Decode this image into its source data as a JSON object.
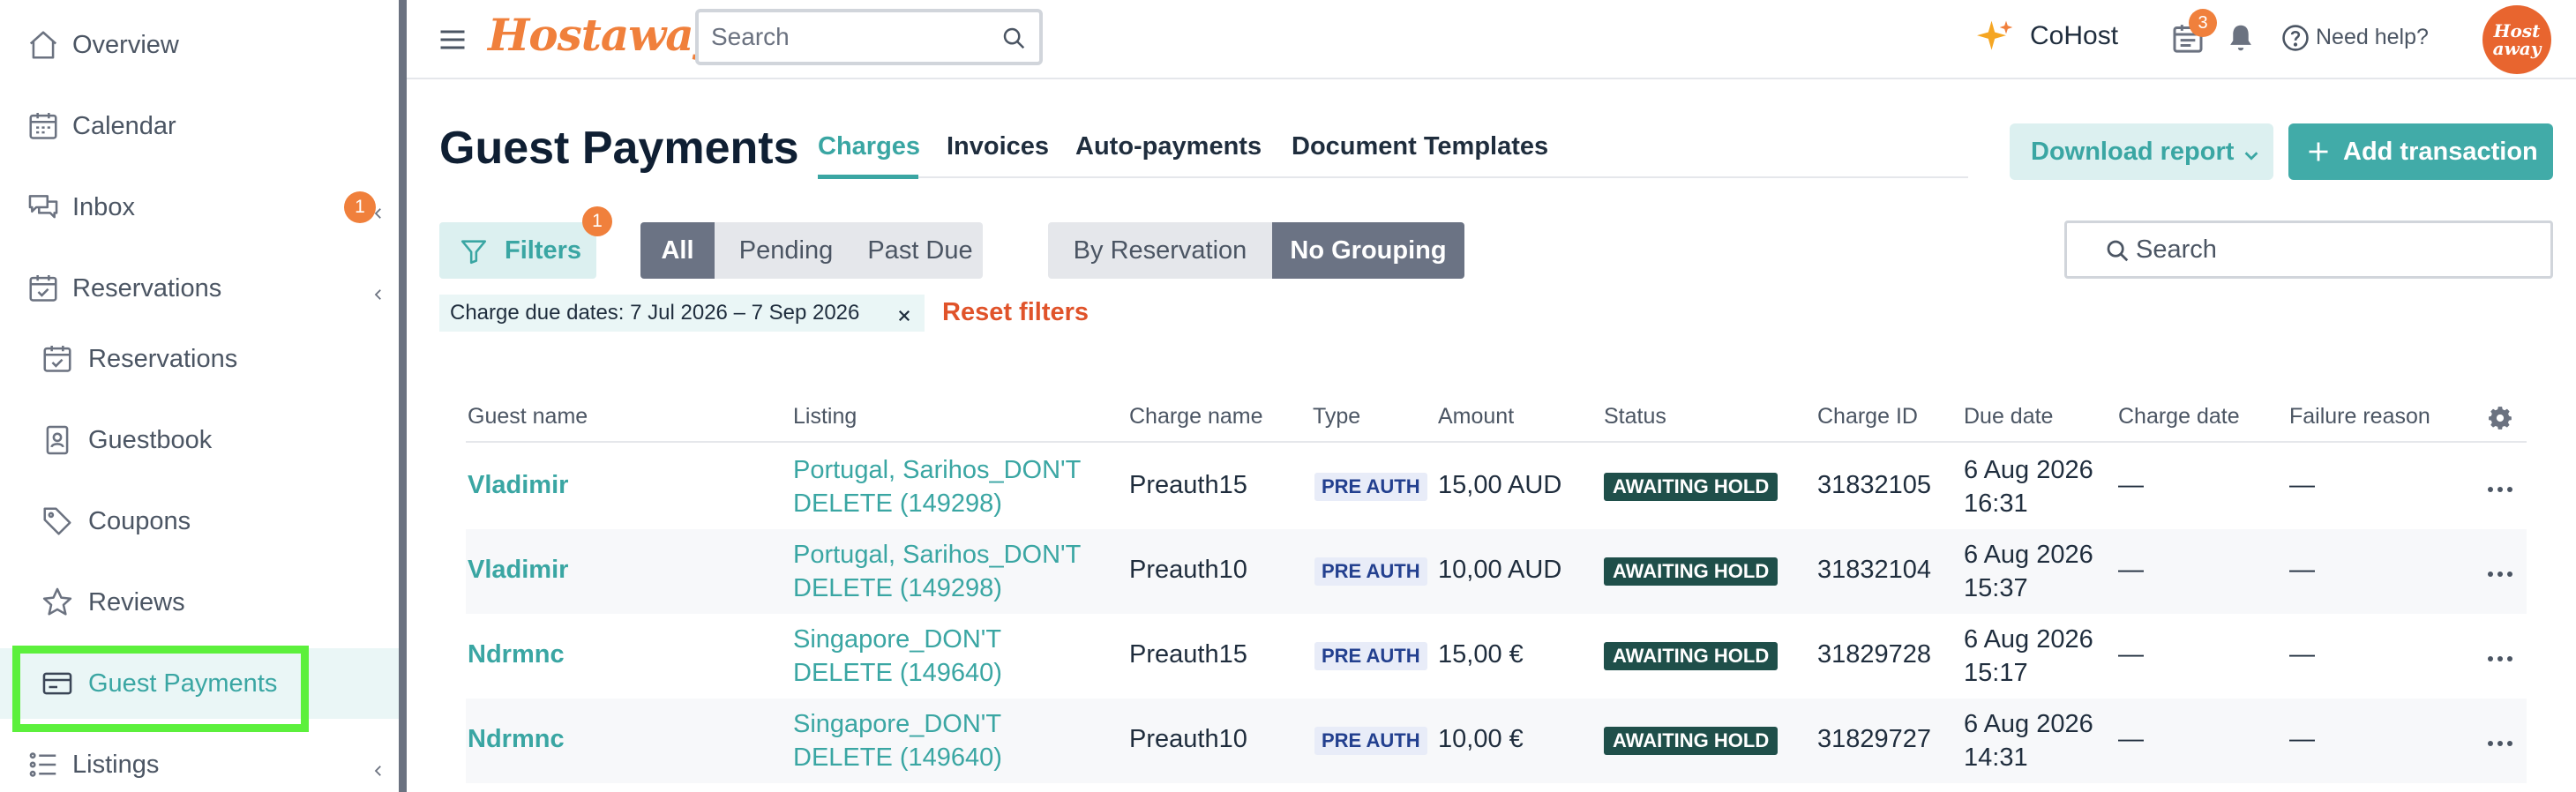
{
  "sidebar": {
    "items": [
      {
        "label": "Overview",
        "icon": "home-icon"
      },
      {
        "label": "Calendar",
        "icon": "calendar-icon"
      },
      {
        "label": "Inbox",
        "icon": "chat-icon",
        "badge": "1"
      },
      {
        "label": "Reservations",
        "icon": "calendar-check-icon"
      },
      {
        "label": "Reservations",
        "icon": "calendar-check-icon"
      },
      {
        "label": "Guestbook",
        "icon": "guestbook-icon"
      },
      {
        "label": "Coupons",
        "icon": "tag-icon"
      },
      {
        "label": "Reviews",
        "icon": "star-icon"
      },
      {
        "label": "Guest Payments",
        "icon": "credit-card-icon"
      },
      {
        "label": "Listings",
        "icon": "list-icon"
      }
    ]
  },
  "topbar": {
    "logo": "Hostaway",
    "search_placeholder": "Search",
    "cohost_label": "CoHost",
    "calendar_badge": "3",
    "help_label": "Need help?",
    "avatar_line1": "Host",
    "avatar_line2": "away"
  },
  "page": {
    "title": "Guest Payments",
    "tabs": [
      "Charges",
      "Invoices",
      "Auto-payments",
      "Document Templates"
    ],
    "active_tab": "Charges",
    "download_label": "Download report",
    "add_label": "Add transaction"
  },
  "filters": {
    "label": "Filters",
    "badge": "1",
    "status_options": [
      "All",
      "Pending",
      "Past Due"
    ],
    "status_selected": "All",
    "grouping_options": [
      "By Reservation",
      "No Grouping"
    ],
    "grouping_selected": "No Grouping",
    "search_placeholder": "Search",
    "chip_label": "Charge due dates: 7 Jul 2026 – 7 Sep 2026",
    "reset_label": "Reset filters"
  },
  "table": {
    "columns": [
      "Guest name",
      "Listing",
      "Charge name",
      "Type",
      "Amount",
      "Status",
      "Charge ID",
      "Due date",
      "Charge date",
      "Failure reason"
    ],
    "rows": [
      {
        "guest": "Vladimir",
        "listing_l1": "Portugal, Sarihos_DON'T",
        "listing_l2": "DELETE (149298)",
        "charge_name": "Preauth15",
        "type": "PRE AUTH",
        "amount": "15,00 AUD",
        "status": "AWAITING HOLD",
        "charge_id": "31832105",
        "due_l1": "6 Aug 2026",
        "due_l2": "16:31",
        "charge_date": "—",
        "failure": "—"
      },
      {
        "guest": "Vladimir",
        "listing_l1": "Portugal, Sarihos_DON'T",
        "listing_l2": "DELETE (149298)",
        "charge_name": "Preauth10",
        "type": "PRE AUTH",
        "amount": "10,00 AUD",
        "status": "AWAITING HOLD",
        "charge_id": "31832104",
        "due_l1": "6 Aug 2026",
        "due_l2": "15:37",
        "charge_date": "—",
        "failure": "—"
      },
      {
        "guest": "Ndrmnc",
        "listing_l1": "Singapore_DON'T",
        "listing_l2": "DELETE (149640)",
        "charge_name": "Preauth15",
        "type": "PRE AUTH",
        "amount": "15,00 €",
        "status": "AWAITING HOLD",
        "charge_id": "31829728",
        "due_l1": "6 Aug 2026",
        "due_l2": "15:17",
        "charge_date": "—",
        "failure": "—"
      },
      {
        "guest": "Ndrmnc",
        "listing_l1": "Singapore_DON'T",
        "listing_l2": "DELETE (149640)",
        "charge_name": "Preauth10",
        "type": "PRE AUTH",
        "amount": "10,00 €",
        "status": "AWAITING HOLD",
        "charge_id": "31829727",
        "due_l1": "6 Aug 2026",
        "due_l2": "14:31",
        "charge_date": "—",
        "failure": "—"
      }
    ]
  },
  "colors": {
    "accent": "#3aa6a3",
    "brand_orange": "#f0803c",
    "status_dark": "#1f4f4a",
    "reset_red": "#e0532a",
    "highlight_green": "#5cf03c"
  }
}
